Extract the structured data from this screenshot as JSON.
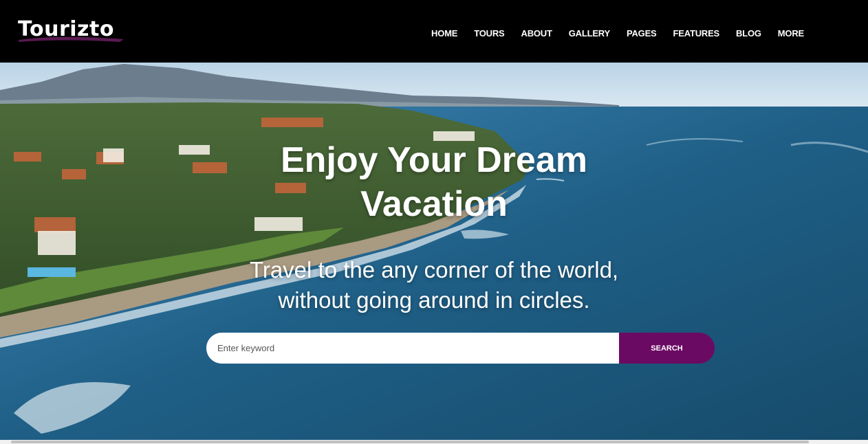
{
  "header": {
    "logo_text": "Tourizto",
    "nav": [
      "HOME",
      "TOURS",
      "ABOUT",
      "GALLERY",
      "PAGES",
      "FEATURES",
      "BLOG",
      "MORE"
    ]
  },
  "hero": {
    "title_line1": "Enjoy Your Dream",
    "title_line2": "Vacation",
    "subtitle_line1": "Travel to the any corner of the world,",
    "subtitle_line2": "without going around in circles.",
    "background_image": "coastal-aerial-photo"
  },
  "search": {
    "placeholder": "Enter keyword",
    "value": "",
    "button_label": "SEARCH"
  },
  "colors": {
    "header_bg": "#000000",
    "accent": "#6b0a63",
    "sea": "#1f5f86"
  }
}
